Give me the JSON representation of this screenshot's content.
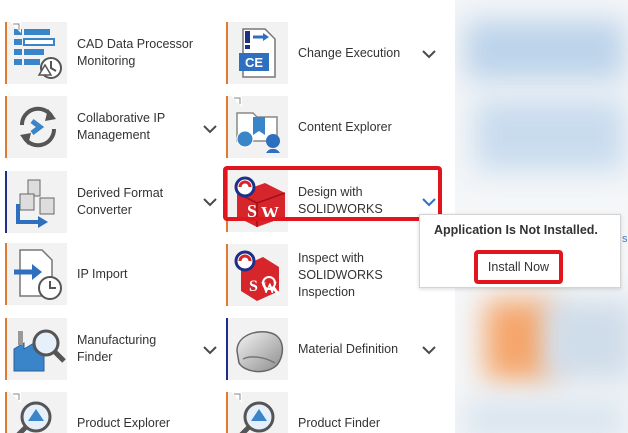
{
  "apps": {
    "left": [
      {
        "label": "CAD Data Processor Monitoring",
        "icon": "cad-monitor-icon"
      },
      {
        "label": "Collaborative IP Management",
        "icon": "sync-arrows-icon"
      },
      {
        "label": "Derived Format Converter",
        "icon": "cube-convert-icon"
      },
      {
        "label": "IP Import",
        "icon": "import-clock-icon"
      },
      {
        "label": "Manufacturing Finder",
        "icon": "factory-search-icon"
      },
      {
        "label": "Product Explorer",
        "icon": "product-search-icon"
      }
    ],
    "right": [
      {
        "label": "Change Execution",
        "icon": "ce-document-icon"
      },
      {
        "label": "Content Explorer",
        "icon": "content-folder-icon"
      },
      {
        "label": "Design with SOLIDWORKS",
        "icon": "solidworks-icon"
      },
      {
        "label": "Inspect with SOLIDWORKS Inspection",
        "icon": "sw-inspection-icon"
      },
      {
        "label": "Material Definition",
        "icon": "material-blob-icon"
      },
      {
        "label": "Product Finder",
        "icon": "product-finder-icon"
      }
    ]
  },
  "popup": {
    "message": "Application Is Not Installed.",
    "install_label": "Install Now"
  },
  "side_fragment": "s",
  "colors": {
    "accent_orange": "#e07a30",
    "accent_navy": "#1d2f86",
    "highlight_red": "#e0151d",
    "chevron": "#4a4a4a",
    "chevron_active": "#2f6fc0"
  }
}
